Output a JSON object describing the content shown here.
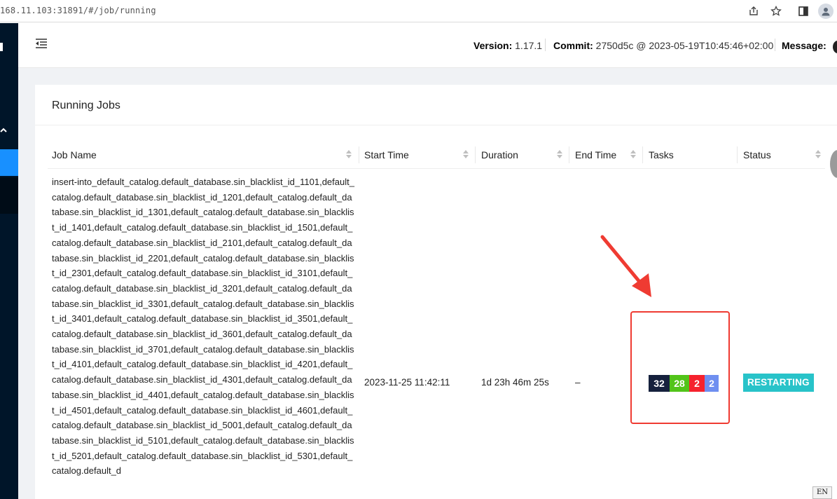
{
  "browser": {
    "url_host": "168.11.103:31891",
    "url_path": "/#/job/running",
    "icons": [
      "share-icon",
      "star-icon",
      "sidebar-panel-icon",
      "profile-icon"
    ]
  },
  "header": {
    "version_label": "Version:",
    "version_value": "1.17.1",
    "commit_label": "Commit:",
    "commit_value": "2750d5c @ 2023-05-19T10:45:46+02:00",
    "message_label": "Message:"
  },
  "card": {
    "title": "Running Jobs"
  },
  "table": {
    "columns": [
      "Job Name",
      "Start Time",
      "Duration",
      "End Time",
      "Tasks",
      "Status"
    ],
    "rows": [
      {
        "job_name": "insert-into_default_catalog.default_database.sin_blacklist_id_1101,default_catalog.default_database.sin_blacklist_id_1201,default_catalog.default_database.sin_blacklist_id_1301,default_catalog.default_database.sin_blacklist_id_1401,default_catalog.default_database.sin_blacklist_id_1501,default_catalog.default_database.sin_blacklist_id_2101,default_catalog.default_database.sin_blacklist_id_2201,default_catalog.default_database.sin_blacklist_id_2301,default_catalog.default_database.sin_blacklist_id_3101,default_catalog.default_database.sin_blacklist_id_3201,default_catalog.default_database.sin_blacklist_id_3301,default_catalog.default_database.sin_blacklist_id_3401,default_catalog.default_database.sin_blacklist_id_3501,default_catalog.default_database.sin_blacklist_id_3601,default_catalog.default_database.sin_blacklist_id_3701,default_catalog.default_database.sin_blacklist_id_4101,default_catalog.default_database.sin_blacklist_id_4201,default_catalog.default_database.sin_blacklist_id_4301,default_catalog.default_database.sin_blacklist_id_4401,default_catalog.default_database.sin_blacklist_id_4501,default_catalog.default_database.sin_blacklist_id_4601,default_catalog.default_database.sin_blacklist_id_5001,default_catalog.default_database.sin_blacklist_id_5101,default_catalog.default_database.sin_blacklist_id_5201,default_catalog.default_database.sin_blacklist_id_5301,default_catalog.default_d",
        "start_time": "2023-11-25 11:42:11",
        "duration": "1d 23h 46m 25s",
        "end_time": "–",
        "tasks": [
          {
            "count": "32",
            "color": "#16213d"
          },
          {
            "count": "28",
            "color": "#52c41a"
          },
          {
            "count": "2",
            "color": "#f5222d"
          },
          {
            "count": "2",
            "color": "#6f8ff0"
          }
        ],
        "status": "RESTARTING",
        "status_color": "#28c3c9"
      }
    ]
  },
  "annotation": {
    "color": "#ef3b32"
  },
  "ime": {
    "label": "EN"
  }
}
